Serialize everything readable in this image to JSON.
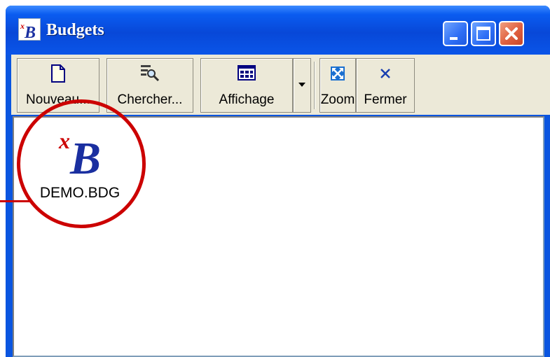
{
  "window": {
    "title": "Budgets",
    "controls": [
      "minimize",
      "maximize",
      "close"
    ],
    "colors": {
      "titlebar": "#0a55e0",
      "close_button": "#e06040",
      "toolbar": "#ece9d8",
      "highlight": "#cc0000"
    }
  },
  "toolbar": {
    "new_label": "Nouveau...",
    "search_label": "Chercher...",
    "view_label": "Affichage",
    "zoom_label": "Zoom",
    "close_label": "Fermer",
    "icons": [
      "new-document-icon",
      "search-icon",
      "view-grid-icon",
      "dropdown-arrow-icon",
      "zoom-icon",
      "close-x-icon"
    ]
  },
  "files": [
    {
      "name": "DEMO.BDG",
      "icon": "xb-budget-file-icon"
    }
  ]
}
